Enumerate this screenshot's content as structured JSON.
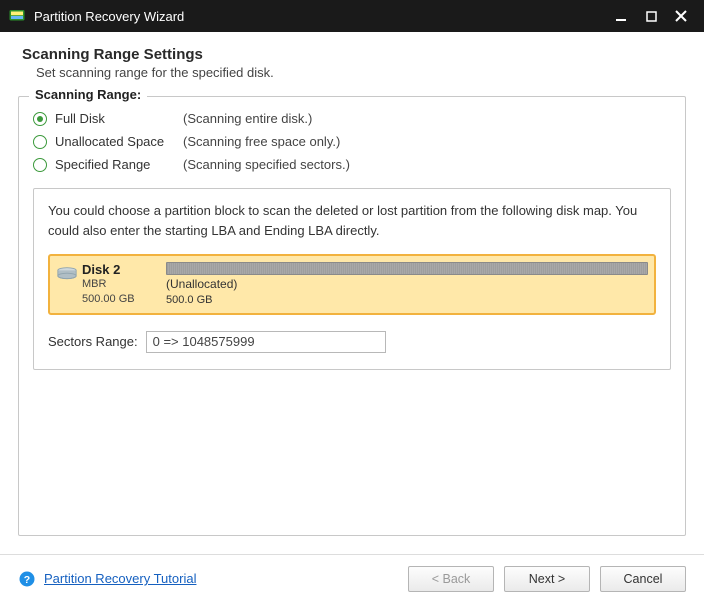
{
  "titlebar": {
    "title": "Partition Recovery Wizard"
  },
  "header": {
    "title": "Scanning Range Settings",
    "subtitle": "Set scanning range for the specified disk."
  },
  "fieldset": {
    "legend": "Scanning Range:"
  },
  "options": [
    {
      "label": "Full Disk",
      "desc": "(Scanning entire disk.)",
      "checked": true
    },
    {
      "label": "Unallocated Space",
      "desc": "(Scanning free space only.)",
      "checked": false
    },
    {
      "label": "Specified Range",
      "desc": "(Scanning specified sectors.)",
      "checked": false
    }
  ],
  "hint": "You could choose a partition block to scan the deleted or lost partition from the following disk map. You could also enter the starting LBA and Ending LBA directly.",
  "disk": {
    "name": "Disk 2",
    "type": "MBR",
    "size": "500.00 GB",
    "block_label": "(Unallocated)",
    "block_size": "500.0 GB"
  },
  "sectors": {
    "label": "Sectors Range:",
    "value": "0 => 1048575999"
  },
  "footer": {
    "tutorial": "Partition Recovery Tutorial",
    "back": "< Back",
    "next": "Next >",
    "cancel": "Cancel"
  }
}
